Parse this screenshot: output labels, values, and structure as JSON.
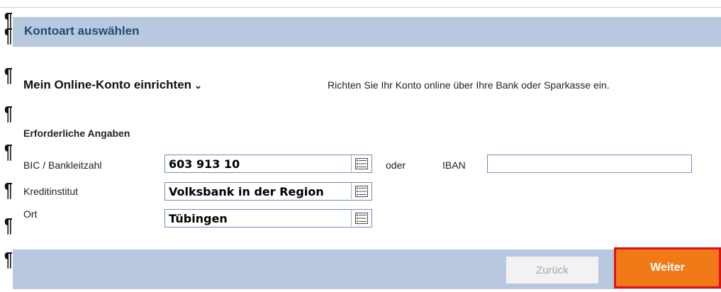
{
  "header": {
    "title": "Kontoart auswählen"
  },
  "section": {
    "title": "Mein Online-Konto einrichten",
    "chevron": "⌄",
    "description": "Richten Sie Ihr Konto online über Ihre Bank oder Sparkasse ein."
  },
  "form": {
    "heading": "Erforderliche Angaben",
    "bic": {
      "label": "BIC / Bankleitzahl",
      "value": "603 913 10"
    },
    "or_label": "oder",
    "iban": {
      "label": "IBAN",
      "value": ""
    },
    "institute": {
      "label": "Kreditinstitut",
      "value": "Volksbank in der Region"
    },
    "city": {
      "label": "Ort",
      "value": "Tübingen"
    }
  },
  "footer": {
    "back_label": "Zurück",
    "next_label": "Weiter"
  },
  "marks": {
    "pilcrow": "¶"
  },
  "colors": {
    "header_bg": "#b8c8de",
    "header_text": "#1f4a7a",
    "next_button": "#f07a18",
    "highlight_border": "#e0101b",
    "field_border": "#6f8fb5"
  }
}
